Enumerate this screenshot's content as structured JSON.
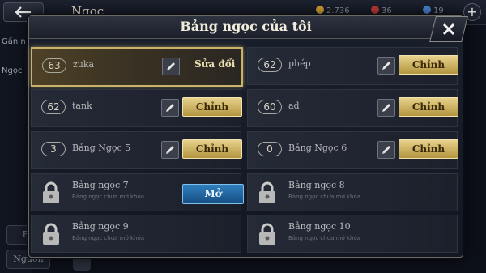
{
  "background": {
    "title": "Ngọc",
    "resources": [
      "2.736",
      "36",
      "19"
    ],
    "left_labels": [
      "Gần n",
      "Ngọc"
    ],
    "left_buttons": [
      "Bả",
      "Nguồn"
    ]
  },
  "modal": {
    "title": "Bảng ngọc của tôi"
  },
  "slots": [
    {
      "level": "63",
      "name": "zuka",
      "action": "Sửa đổi"
    },
    {
      "level": "62",
      "name": "phép",
      "action": "Chỉnh"
    },
    {
      "level": "62",
      "name": "tank",
      "action": "Chỉnh"
    },
    {
      "level": "60",
      "name": "ad",
      "action": "Chỉnh"
    },
    {
      "level": "3",
      "name": "Bảng Ngọc 5",
      "action": "Chỉnh"
    },
    {
      "level": "0",
      "name": "Bảng Ngọc 6",
      "action": "Chỉnh"
    }
  ],
  "locked": [
    {
      "name": "Bảng ngọc 7",
      "sub": "Bảng ngọc chưa mở khóa",
      "action": "Mở"
    },
    {
      "name": "Bảng ngọc 8",
      "sub": "Bảng ngọc chưa mở khóa"
    },
    {
      "name": "Bảng ngọc 9",
      "sub": "Bảng ngọc chưa mở khóa"
    },
    {
      "name": "Bảng ngọc 10",
      "sub": "Bảng ngọc chưa mở khóa"
    }
  ],
  "colors": {
    "accent_gold": "#c9b26a",
    "button_blue": "#2f7fbf"
  }
}
